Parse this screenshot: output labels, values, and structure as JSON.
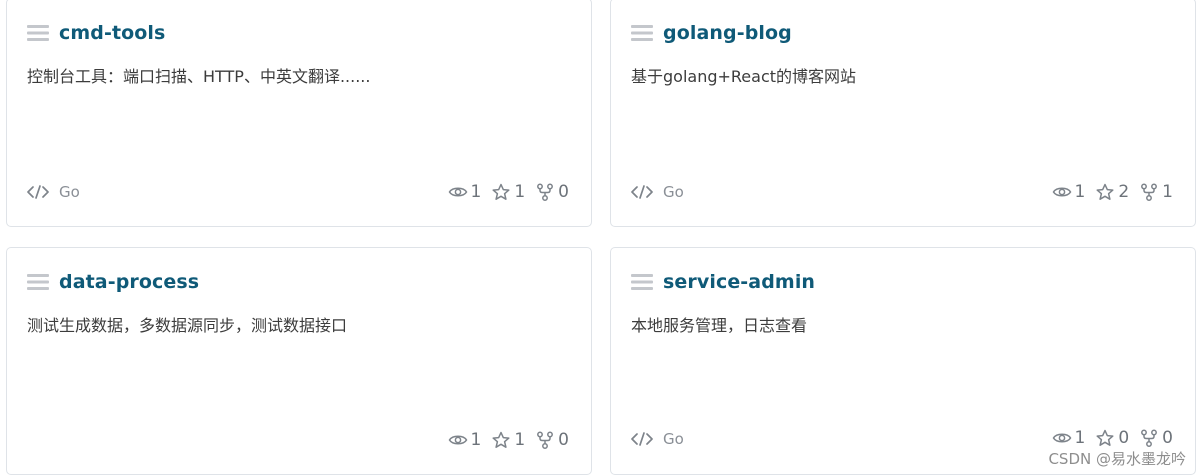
{
  "cards": [
    {
      "name": "cmd-tools",
      "description": "控制台工具：端口扫描、HTTP、中英文翻译......",
      "language": "Go",
      "views": "1",
      "stars": "1",
      "forks": "0"
    },
    {
      "name": "golang-blog",
      "description": "基于golang+React的博客网站",
      "language": "Go",
      "views": "1",
      "stars": "2",
      "forks": "1"
    },
    {
      "name": "data-process",
      "description": "测试生成数据，多数据源同步，测试数据接口",
      "language": "",
      "views": "1",
      "stars": "1",
      "forks": "0"
    },
    {
      "name": "service-admin",
      "description": "本地服务管理，日志查看",
      "language": "Go",
      "views": "1",
      "stars": "0",
      "forks": "0"
    }
  ],
  "watermark": "CSDN @易水墨龙吟",
  "colors": {
    "title": "#0f5a78",
    "border": "#dfe3e8",
    "muted": "#8a8f96"
  }
}
